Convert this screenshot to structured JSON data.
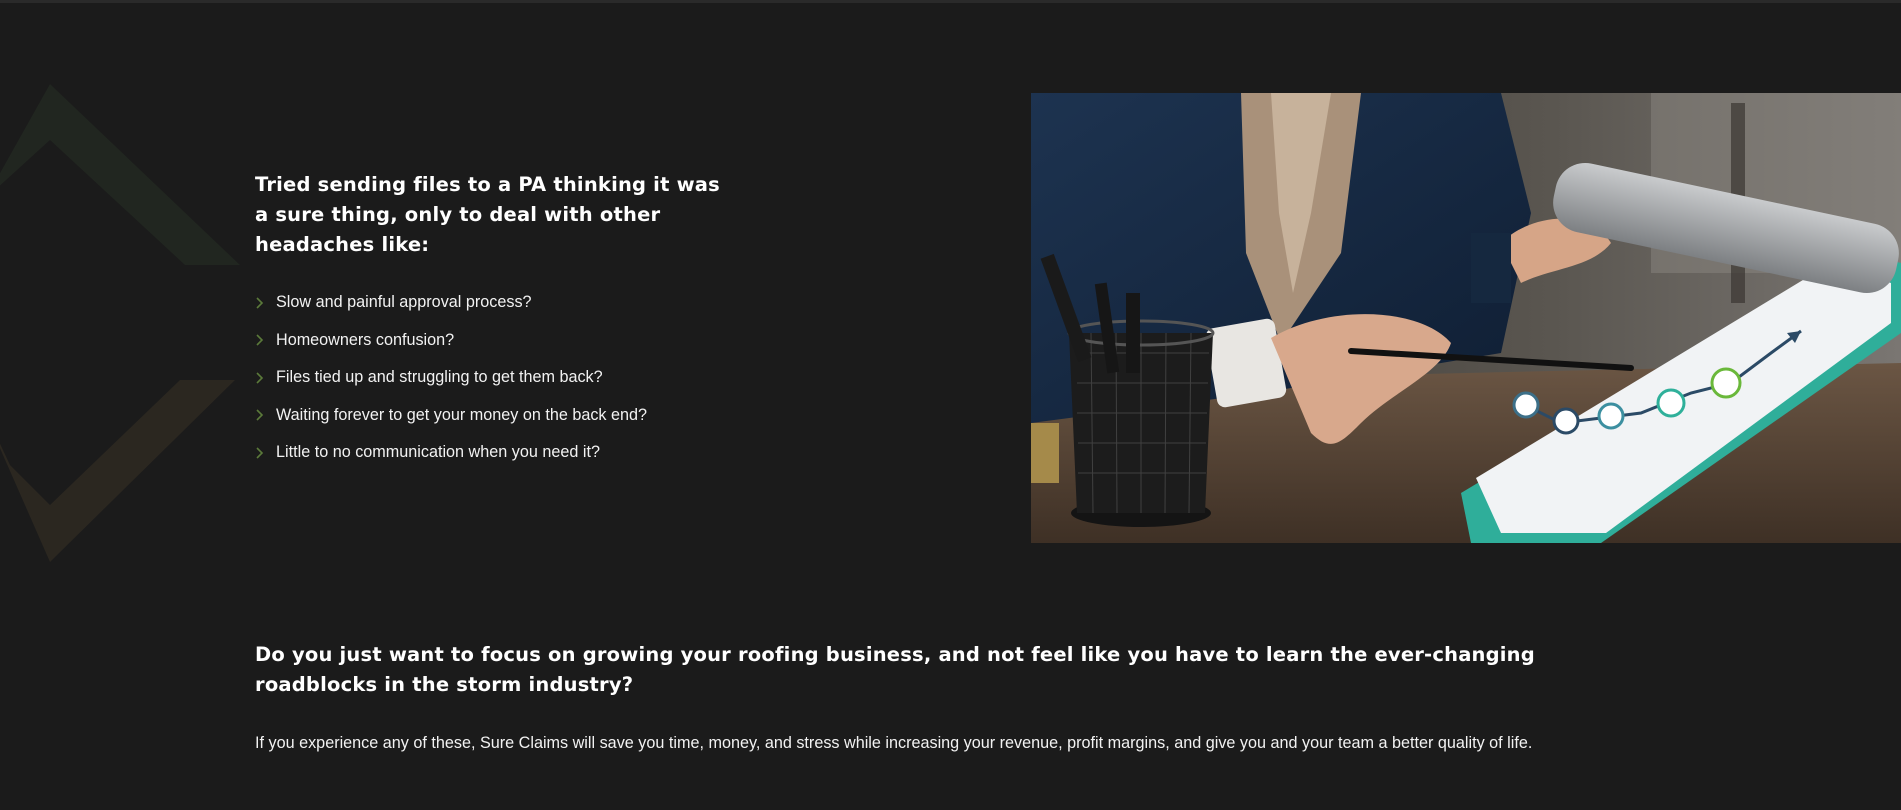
{
  "colors": {
    "background": "#1b1b1b",
    "accent_green": "#5b7a3a",
    "deco_dark": "#222820",
    "deco_olive": "#2e2a22",
    "text": "#ffffff"
  },
  "problem": {
    "title": "Tried sending files to a PA thinking it was a sure thing, only to deal with other headaches like:",
    "bullet_icon": "chevron-right-icon",
    "items": [
      "Slow and painful approval process?",
      "Homeowners confusion?",
      "Files tied up and struggling to get them back?",
      "Waiting forever to get your money on the back end?",
      "Little to no communication when you need it?"
    ]
  },
  "image": {
    "subject": "business-person-pointing-at-growth-chart-photo"
  },
  "question": {
    "text": "Do you just want to focus on growing your roofing business, and not feel like you have to learn the ever-changing roadblocks in the storm industry?"
  },
  "summary": {
    "text": "If you experience any of these, Sure Claims will save you time, money, and stress while increasing your revenue, profit margins, and give you and your team a better quality of life."
  }
}
